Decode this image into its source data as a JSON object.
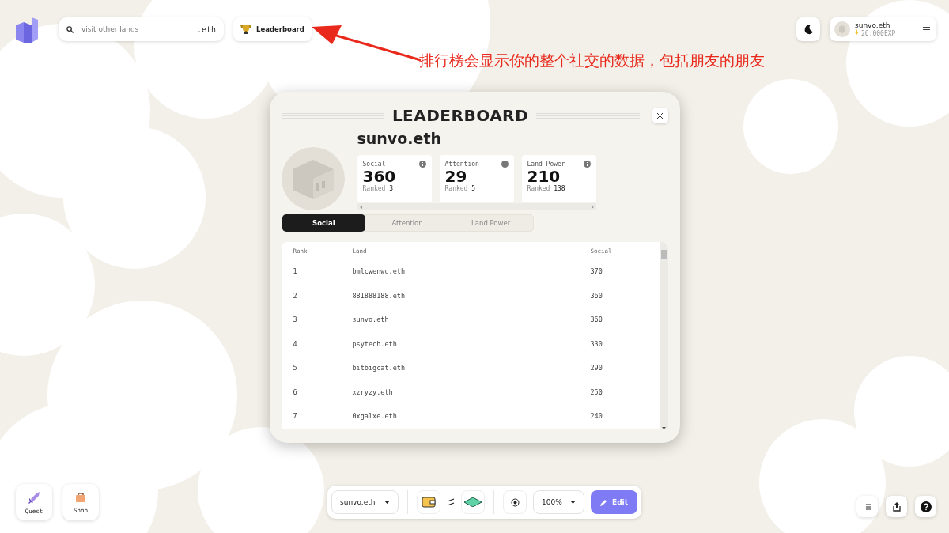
{
  "search": {
    "placeholder": "visit other lands",
    "suffix": ".eth"
  },
  "leaderboard_button": {
    "label": "Leaderboard"
  },
  "annotation": {
    "text": "排行榜会显示你的整个社交的数据，包括朋友的朋友"
  },
  "account": {
    "name": "sunvo.eth",
    "exp": "26,000EXP"
  },
  "modal": {
    "title": "LEADERBOARD",
    "user": "sunvo.eth",
    "stats": [
      {
        "label": "Social",
        "value": "360",
        "ranked_label": "Ranked",
        "rank": "3"
      },
      {
        "label": "Attention",
        "value": "29",
        "ranked_label": "Ranked",
        "rank": "5"
      },
      {
        "label": "Land Power",
        "value": "210",
        "ranked_label": "Ranked",
        "rank": "138"
      }
    ],
    "tabs": [
      {
        "label": "Social",
        "selected": true
      },
      {
        "label": "Attention",
        "selected": false
      },
      {
        "label": "Land Power",
        "selected": false
      }
    ],
    "table": {
      "columns": [
        "Rank",
        "Land",
        "Social"
      ],
      "rows": [
        [
          "1",
          "bmlcwenwu.eth",
          "370"
        ],
        [
          "2",
          "881888188.eth",
          "360"
        ],
        [
          "3",
          "sunvo.eth",
          "360"
        ],
        [
          "4",
          "psytech.eth",
          "330"
        ],
        [
          "5",
          "bitbigcat.eth",
          "290"
        ],
        [
          "6",
          "xzryzy.eth",
          "250"
        ],
        [
          "7",
          "0xgalxe.eth",
          "240"
        ]
      ]
    }
  },
  "side_buttons": [
    {
      "label": "Quest",
      "kind": "sword"
    },
    {
      "label": "Shop",
      "kind": "bag"
    }
  ],
  "toolbar": {
    "land": "sunvo.eth",
    "zoom": "100%",
    "edit": "Edit"
  }
}
